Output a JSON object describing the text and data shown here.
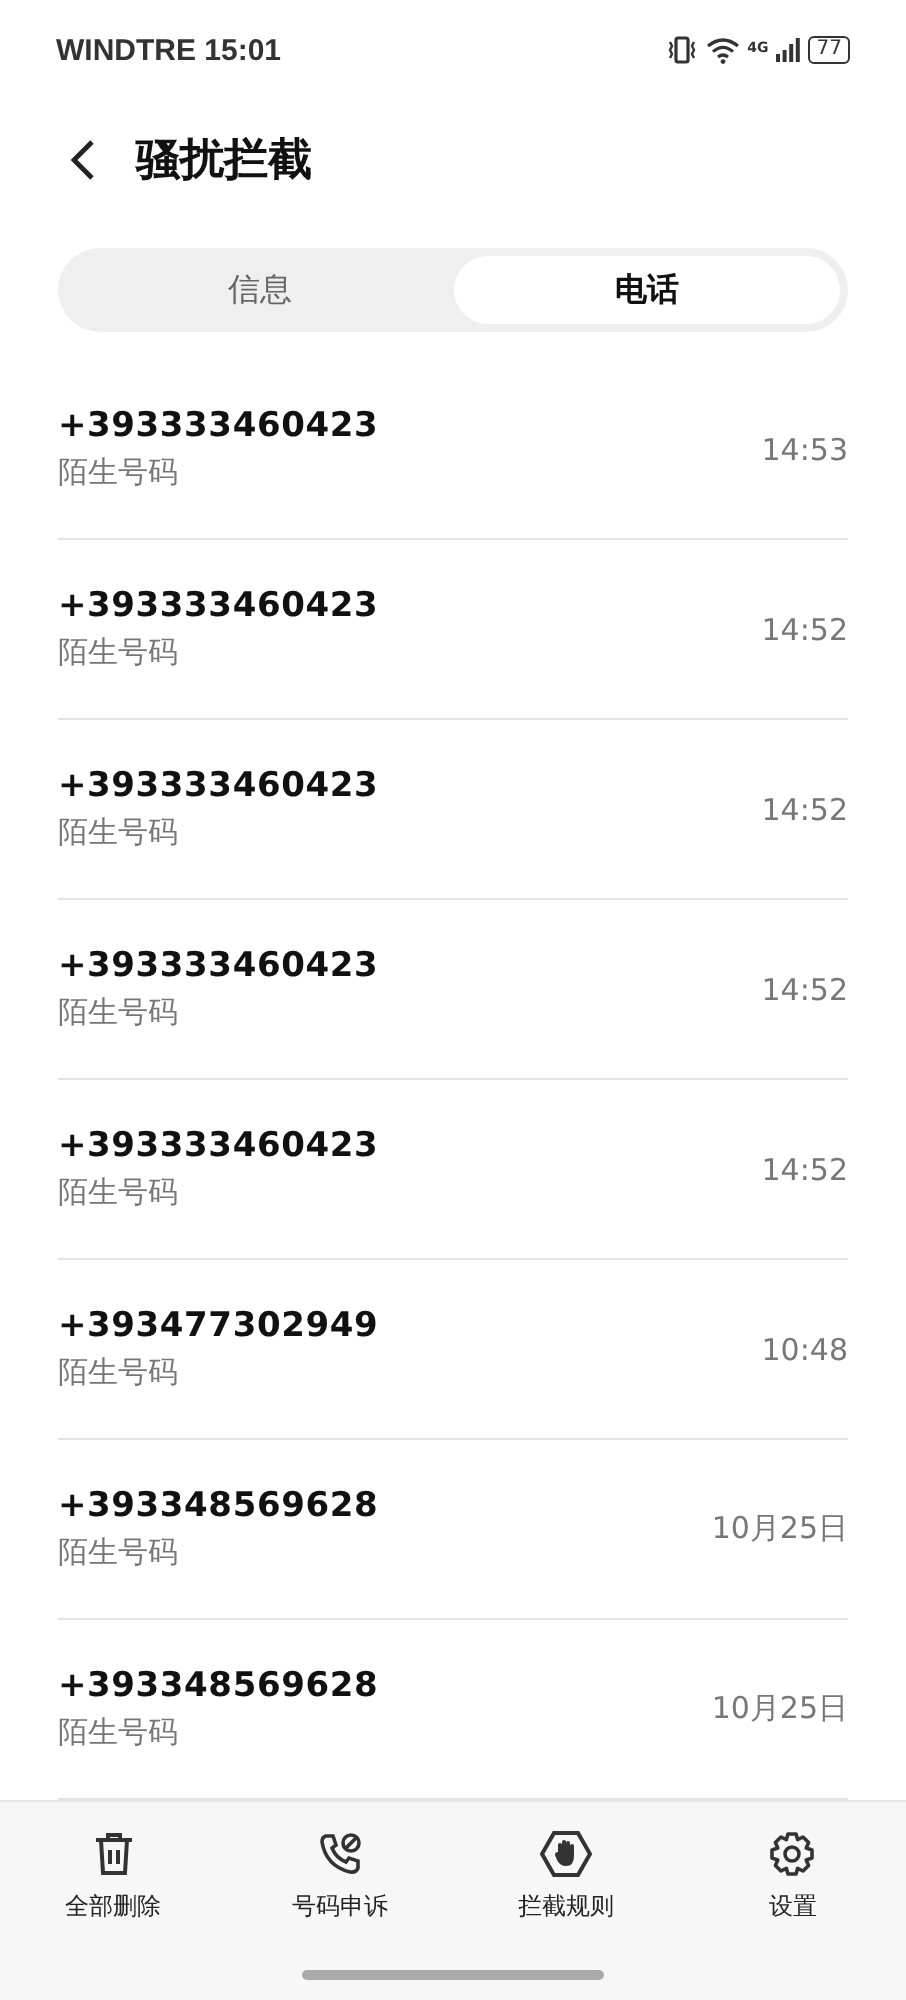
{
  "status_bar": {
    "carrier_time": "WINDTRE 15:01",
    "network": "4G",
    "battery": "77"
  },
  "header": {
    "title": "骚扰拦截"
  },
  "tabs": [
    {
      "label": "信息",
      "selected": false
    },
    {
      "label": "电话",
      "selected": true
    }
  ],
  "calls": [
    {
      "number": "+393333460423",
      "label": "陌生号码",
      "time": "14:53"
    },
    {
      "number": "+393333460423",
      "label": "陌生号码",
      "time": "14:52"
    },
    {
      "number": "+393333460423",
      "label": "陌生号码",
      "time": "14:52"
    },
    {
      "number": "+393333460423",
      "label": "陌生号码",
      "time": "14:52"
    },
    {
      "number": "+393333460423",
      "label": "陌生号码",
      "time": "14:52"
    },
    {
      "number": "+393477302949",
      "label": "陌生号码",
      "time": "10:48"
    },
    {
      "number": "+393348569628",
      "label": "陌生号码",
      "time": "10月25日"
    },
    {
      "number": "+393348569628",
      "label": "陌生号码",
      "time": "10月25日"
    }
  ],
  "bottom_bar": [
    {
      "kind": "trash",
      "label": "全部删除"
    },
    {
      "kind": "appeal",
      "label": "号码申诉"
    },
    {
      "kind": "rules",
      "label": "拦截规则"
    },
    {
      "kind": "settings",
      "label": "设置"
    }
  ]
}
